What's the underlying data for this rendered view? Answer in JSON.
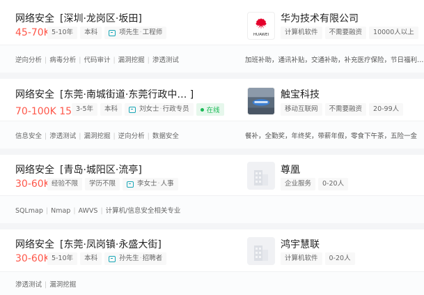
{
  "colors": {
    "salary": "#fe574a",
    "accent": "#16a6b6",
    "online": "#19b955"
  },
  "jobs": [
    {
      "title": "网络安全",
      "location": "[深圳·龙岗区·坂田]",
      "salary": "45-70K",
      "tags": [
        "5-10年",
        "本科"
      ],
      "recruiter": {
        "name": "项先生",
        "role": "工程师"
      },
      "online": null,
      "skills": [
        "逆向分析",
        "病毒分析",
        "代码审计",
        "漏洞挖掘",
        "渗透测试"
      ],
      "company": "华为技术有限公司",
      "company_logo": "huawei-logo",
      "company_logo_text": "HUAWEI",
      "company_tags": [
        "计算机软件",
        "不需要融资",
        "10000人以上"
      ],
      "welfare": "加班补助，通讯补贴，交通补助，补充医疗保险，节日福利…"
    },
    {
      "title": "网络安全",
      "location": "[东莞·南城街道·东莞行政中…  ]",
      "salary": "70-100K 15薪",
      "tags": [
        "3-5年",
        "本科"
      ],
      "recruiter": {
        "name": "刘女士",
        "role": "行政专员"
      },
      "online": "在线",
      "skills": [
        "信息安全",
        "渗透测试",
        "漏洞挖掘",
        "逆向分析",
        "数据安全"
      ],
      "company": "触宝科技",
      "company_logo": "chubao-logo",
      "company_tags": [
        "移动互联网",
        "不需要融资",
        "20-99人"
      ],
      "welfare": "餐补，全勤奖，年终奖，带薪年假，零食下午茶，五险一金"
    },
    {
      "title": "网络安全",
      "location": "[青岛·城阳区·流亭]",
      "salary": "30-60K",
      "tags": [
        "经验不限",
        "学历不限"
      ],
      "recruiter": {
        "name": "李女士",
        "role": "人事"
      },
      "online": null,
      "skills": [
        "SQLmap",
        "Nmap",
        "AWVS",
        "计算机/信息安全相关专业"
      ],
      "company": "尊凰",
      "company_logo": "building-icon",
      "company_tags": [
        "企业服务",
        "0-20人"
      ],
      "welfare": ""
    },
    {
      "title": "网络安全",
      "location": "[东莞·凤岗镇·永盛大街]",
      "salary": "30-60K",
      "tags": [
        "5-10年",
        "本科"
      ],
      "recruiter": {
        "name": "孙先生",
        "role": "招聘者"
      },
      "online": null,
      "skills": [
        "渗透测试",
        "漏洞挖掘"
      ],
      "company": "鸿宇慧联",
      "company_logo": "building-icon",
      "company_tags": [
        "计算机软件",
        "0-20人"
      ],
      "welfare": ""
    }
  ]
}
